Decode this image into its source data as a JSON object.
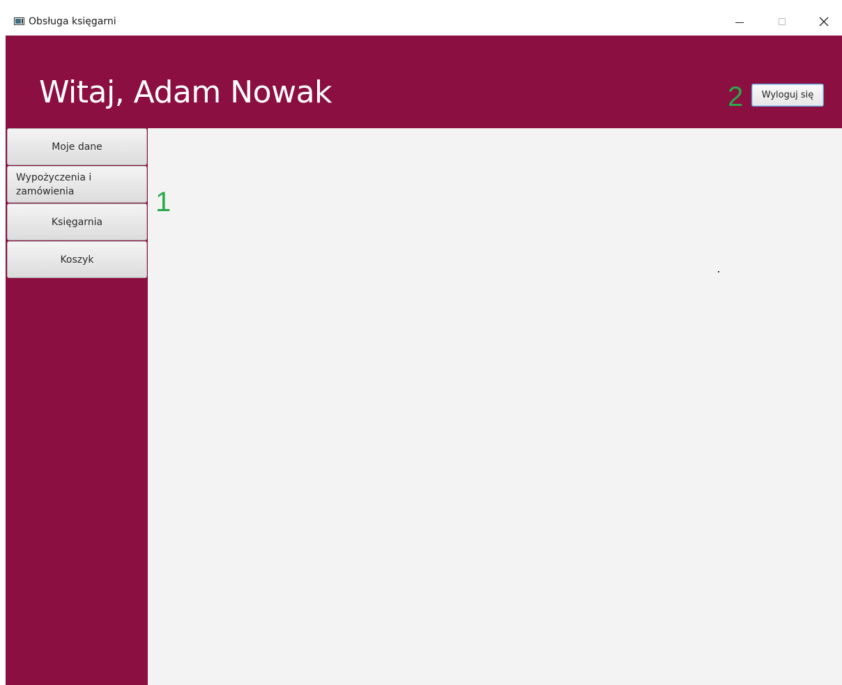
{
  "window": {
    "title": "Obsługa księgarni",
    "icon": "window-app-icon",
    "controls": {
      "minimize_icon": "minimize-icon",
      "maximize_icon": "maximize-icon",
      "close_icon": "close-icon",
      "close_glyph": "✕"
    }
  },
  "header": {
    "welcome": "Witaj, Adam Nowak",
    "logout_label": "Wyloguj się",
    "marker_2": "2"
  },
  "sidebar": {
    "items": [
      {
        "label": "Moje dane"
      },
      {
        "label": "Wypożyczenia i zamówienia"
      },
      {
        "label": "Księgarnia"
      },
      {
        "label": "Koszyk"
      }
    ],
    "marker_1": "1"
  },
  "colors": {
    "accent": "#8c0f42",
    "marker": "#2aa84a",
    "content_bg": "#f3f3f3"
  }
}
